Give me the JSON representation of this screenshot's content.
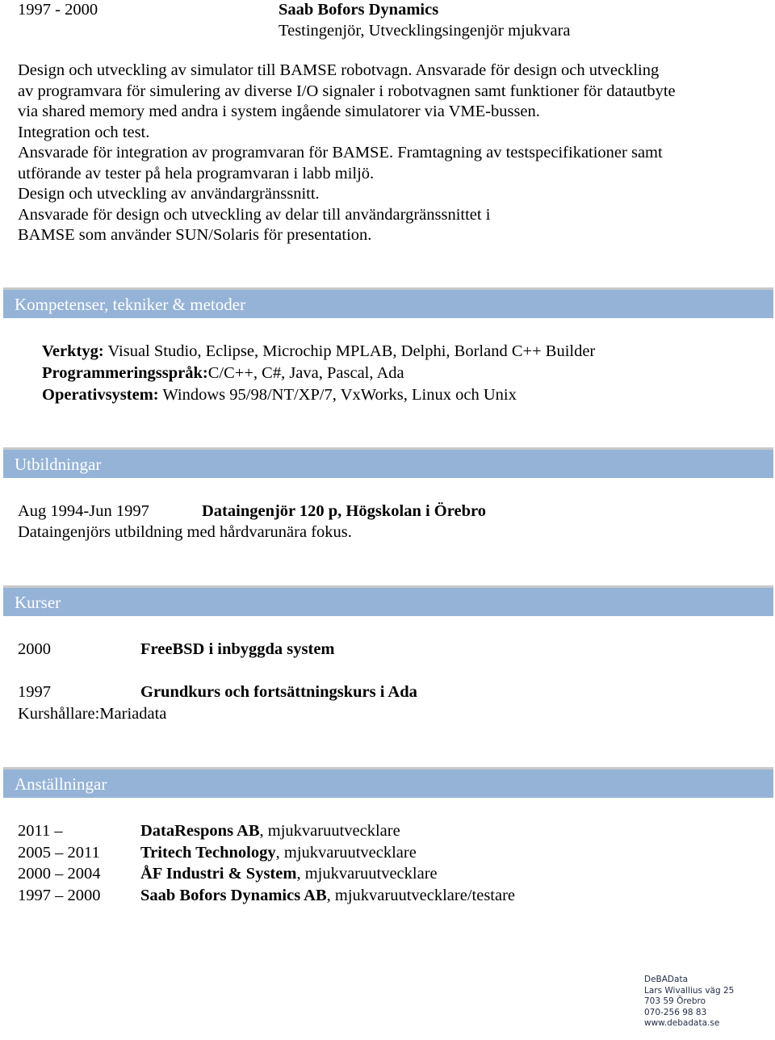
{
  "top_job": {
    "period": "1997 - 2000",
    "company": "Saab Bofors Dynamics",
    "role": "Testingenjör, Utvecklingsingenjör mjukvara",
    "description_lines": [
      "Design och utveckling av simulator till BAMSE robotvagn. Ansvarade för design och utveckling",
      "av programvara för simulering av diverse I/O signaler i robotvagnen samt funktioner för datautbyte",
      "via shared memory med andra i system ingående simulatorer via VME-bussen.",
      "Integration och test.",
      "Ansvarade för integration av programvaran för BAMSE. Framtagning av testspecifikationer samt",
      "utförande av tester på hela programvaran i labb miljö.",
      "Design och utveckling av användargränssnitt.",
      "Ansvarade för design och utveckling av delar till användargränssnittet i",
      "BAMSE som använder SUN/Solaris för presentation."
    ]
  },
  "sections": {
    "skills": {
      "title": "Kompetenser, tekniker & metoder",
      "items": [
        {
          "label": "Verktyg:",
          "value": " Visual Studio, Eclipse, Microchip MPLAB, Delphi, Borland C++ Builder"
        },
        {
          "label": "Programmeringsspråk:",
          "value": "C/C++, C#, Java, Pascal, Ada"
        },
        {
          "label": "Operativsystem:",
          "value": " Windows 95/98/NT/XP/7, VxWorks, Linux och Unix"
        }
      ]
    },
    "education": {
      "title": "Utbildningar",
      "period": "Aug 1994-Jun 1997",
      "degree": "Dataingenjör 120 p, Högskolan i Örebro",
      "description": "Dataingenjörs utbildning med hårdvarunära fokus."
    },
    "courses": {
      "title": "Kurser",
      "items": [
        {
          "year": "2000",
          "name": "FreeBSD i inbyggda system",
          "note": ""
        },
        {
          "year": "1997",
          "name": "Grundkurs och fortsättningskurs i Ada",
          "note": "Kurshållare:Mariadata"
        }
      ]
    },
    "employments": {
      "title": "Anställningar",
      "items": [
        {
          "period": "2011 –",
          "company": "DataRespons AB",
          "role": ", mjukvaruutvecklare"
        },
        {
          "period": "2005 – 2011",
          "company": "Tritech Technology",
          "role": ", mjukvaruutvecklare"
        },
        {
          "period": "2000 – 2004",
          "company": "ÅF Industri & System",
          "role": ", mjukvaruutvecklare"
        },
        {
          "period": "1997 – 2000",
          "company": "Saab Bofors Dynamics AB",
          "role": ", mjukvaruutvecklare/testare"
        }
      ]
    }
  },
  "footer": {
    "company": "DeBAData",
    "street": "Lars Wivallius väg 25",
    "city": "703 59  Örebro",
    "phone": "070-256 98 83",
    "website": "www.debadata.se"
  },
  "colors": {
    "section_band": "#95b3d7",
    "section_text": "#ffffff"
  }
}
